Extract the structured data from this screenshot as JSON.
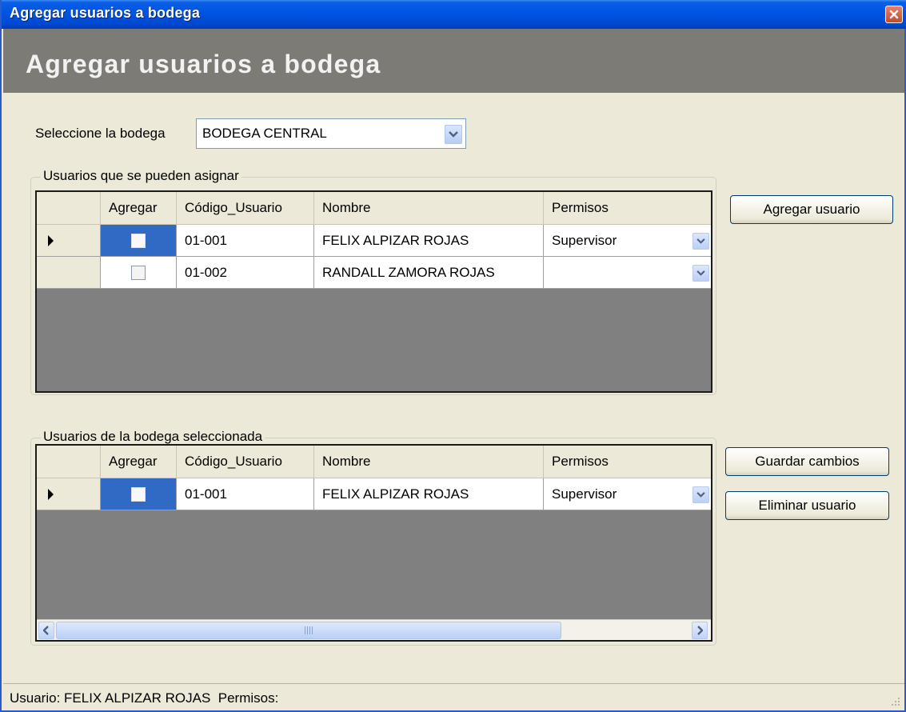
{
  "window": {
    "title": "Agregar usuarios a bodega",
    "header_title": "Agregar usuarios a bodega"
  },
  "selector": {
    "label": "Seleccione la bodega",
    "value": "BODEGA CENTRAL"
  },
  "available": {
    "legend": "Usuarios que se pueden asignar",
    "columns": [
      "Agregar",
      "Código_Usuario",
      "Nombre",
      "Permisos"
    ],
    "rows": [
      {
        "agregar": false,
        "codigo": "01-001",
        "nombre": "FELIX ALPIZAR ROJAS",
        "permisos": "Supervisor",
        "current": true
      },
      {
        "agregar": false,
        "codigo": "01-002",
        "nombre": "RANDALL ZAMORA ROJAS",
        "permisos": "",
        "current": false
      }
    ]
  },
  "assigned": {
    "legend": "Usuarios de la bodega seleccionada",
    "columns": [
      "Agregar",
      "Código_Usuario",
      "Nombre",
      "Permisos"
    ],
    "rows": [
      {
        "agregar": false,
        "codigo": "01-001",
        "nombre": "FELIX ALPIZAR ROJAS",
        "permisos": "Supervisor",
        "current": true
      }
    ]
  },
  "buttons": {
    "agregar_usuario": "Agregar usuario",
    "guardar_cambios": "Guardar cambios",
    "eliminar_usuario": "Eliminar usuario"
  },
  "status": {
    "text": "Usuario: FELIX ALPIZAR ROJAS  Permisos:"
  },
  "icons": {
    "close": "close-icon",
    "dropdown": "chevron-down-icon",
    "row_indicator": "row-pointer-icon",
    "scroll_left": "chevron-left-icon",
    "scroll_right": "chevron-right-icon"
  }
}
